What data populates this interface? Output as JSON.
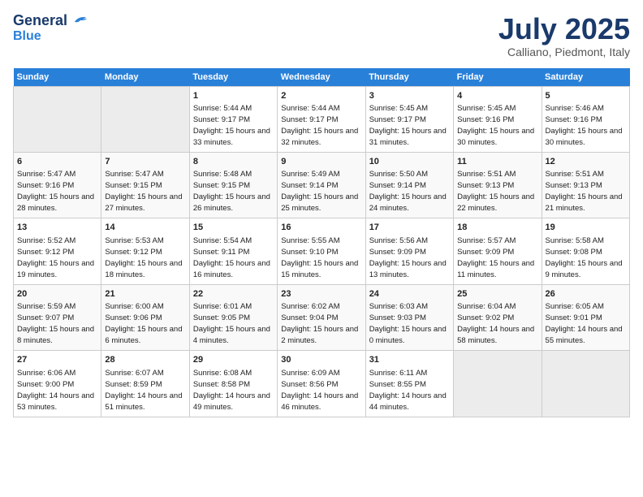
{
  "header": {
    "logo_line1": "General",
    "logo_line2": "Blue",
    "month": "July 2025",
    "location": "Calliano, Piedmont, Italy"
  },
  "columns": [
    "Sunday",
    "Monday",
    "Tuesday",
    "Wednesday",
    "Thursday",
    "Friday",
    "Saturday"
  ],
  "weeks": [
    [
      {
        "day": "",
        "sunrise": "",
        "sunset": "",
        "daylight": ""
      },
      {
        "day": "",
        "sunrise": "",
        "sunset": "",
        "daylight": ""
      },
      {
        "day": "1",
        "sunrise": "Sunrise: 5:44 AM",
        "sunset": "Sunset: 9:17 PM",
        "daylight": "Daylight: 15 hours and 33 minutes."
      },
      {
        "day": "2",
        "sunrise": "Sunrise: 5:44 AM",
        "sunset": "Sunset: 9:17 PM",
        "daylight": "Daylight: 15 hours and 32 minutes."
      },
      {
        "day": "3",
        "sunrise": "Sunrise: 5:45 AM",
        "sunset": "Sunset: 9:17 PM",
        "daylight": "Daylight: 15 hours and 31 minutes."
      },
      {
        "day": "4",
        "sunrise": "Sunrise: 5:45 AM",
        "sunset": "Sunset: 9:16 PM",
        "daylight": "Daylight: 15 hours and 30 minutes."
      },
      {
        "day": "5",
        "sunrise": "Sunrise: 5:46 AM",
        "sunset": "Sunset: 9:16 PM",
        "daylight": "Daylight: 15 hours and 30 minutes."
      }
    ],
    [
      {
        "day": "6",
        "sunrise": "Sunrise: 5:47 AM",
        "sunset": "Sunset: 9:16 PM",
        "daylight": "Daylight: 15 hours and 28 minutes."
      },
      {
        "day": "7",
        "sunrise": "Sunrise: 5:47 AM",
        "sunset": "Sunset: 9:15 PM",
        "daylight": "Daylight: 15 hours and 27 minutes."
      },
      {
        "day": "8",
        "sunrise": "Sunrise: 5:48 AM",
        "sunset": "Sunset: 9:15 PM",
        "daylight": "Daylight: 15 hours and 26 minutes."
      },
      {
        "day": "9",
        "sunrise": "Sunrise: 5:49 AM",
        "sunset": "Sunset: 9:14 PM",
        "daylight": "Daylight: 15 hours and 25 minutes."
      },
      {
        "day": "10",
        "sunrise": "Sunrise: 5:50 AM",
        "sunset": "Sunset: 9:14 PM",
        "daylight": "Daylight: 15 hours and 24 minutes."
      },
      {
        "day": "11",
        "sunrise": "Sunrise: 5:51 AM",
        "sunset": "Sunset: 9:13 PM",
        "daylight": "Daylight: 15 hours and 22 minutes."
      },
      {
        "day": "12",
        "sunrise": "Sunrise: 5:51 AM",
        "sunset": "Sunset: 9:13 PM",
        "daylight": "Daylight: 15 hours and 21 minutes."
      }
    ],
    [
      {
        "day": "13",
        "sunrise": "Sunrise: 5:52 AM",
        "sunset": "Sunset: 9:12 PM",
        "daylight": "Daylight: 15 hours and 19 minutes."
      },
      {
        "day": "14",
        "sunrise": "Sunrise: 5:53 AM",
        "sunset": "Sunset: 9:12 PM",
        "daylight": "Daylight: 15 hours and 18 minutes."
      },
      {
        "day": "15",
        "sunrise": "Sunrise: 5:54 AM",
        "sunset": "Sunset: 9:11 PM",
        "daylight": "Daylight: 15 hours and 16 minutes."
      },
      {
        "day": "16",
        "sunrise": "Sunrise: 5:55 AM",
        "sunset": "Sunset: 9:10 PM",
        "daylight": "Daylight: 15 hours and 15 minutes."
      },
      {
        "day": "17",
        "sunrise": "Sunrise: 5:56 AM",
        "sunset": "Sunset: 9:09 PM",
        "daylight": "Daylight: 15 hours and 13 minutes."
      },
      {
        "day": "18",
        "sunrise": "Sunrise: 5:57 AM",
        "sunset": "Sunset: 9:09 PM",
        "daylight": "Daylight: 15 hours and 11 minutes."
      },
      {
        "day": "19",
        "sunrise": "Sunrise: 5:58 AM",
        "sunset": "Sunset: 9:08 PM",
        "daylight": "Daylight: 15 hours and 9 minutes."
      }
    ],
    [
      {
        "day": "20",
        "sunrise": "Sunrise: 5:59 AM",
        "sunset": "Sunset: 9:07 PM",
        "daylight": "Daylight: 15 hours and 8 minutes."
      },
      {
        "day": "21",
        "sunrise": "Sunrise: 6:00 AM",
        "sunset": "Sunset: 9:06 PM",
        "daylight": "Daylight: 15 hours and 6 minutes."
      },
      {
        "day": "22",
        "sunrise": "Sunrise: 6:01 AM",
        "sunset": "Sunset: 9:05 PM",
        "daylight": "Daylight: 15 hours and 4 minutes."
      },
      {
        "day": "23",
        "sunrise": "Sunrise: 6:02 AM",
        "sunset": "Sunset: 9:04 PM",
        "daylight": "Daylight: 15 hours and 2 minutes."
      },
      {
        "day": "24",
        "sunrise": "Sunrise: 6:03 AM",
        "sunset": "Sunset: 9:03 PM",
        "daylight": "Daylight: 15 hours and 0 minutes."
      },
      {
        "day": "25",
        "sunrise": "Sunrise: 6:04 AM",
        "sunset": "Sunset: 9:02 PM",
        "daylight": "Daylight: 14 hours and 58 minutes."
      },
      {
        "day": "26",
        "sunrise": "Sunrise: 6:05 AM",
        "sunset": "Sunset: 9:01 PM",
        "daylight": "Daylight: 14 hours and 55 minutes."
      }
    ],
    [
      {
        "day": "27",
        "sunrise": "Sunrise: 6:06 AM",
        "sunset": "Sunset: 9:00 PM",
        "daylight": "Daylight: 14 hours and 53 minutes."
      },
      {
        "day": "28",
        "sunrise": "Sunrise: 6:07 AM",
        "sunset": "Sunset: 8:59 PM",
        "daylight": "Daylight: 14 hours and 51 minutes."
      },
      {
        "day": "29",
        "sunrise": "Sunrise: 6:08 AM",
        "sunset": "Sunset: 8:58 PM",
        "daylight": "Daylight: 14 hours and 49 minutes."
      },
      {
        "day": "30",
        "sunrise": "Sunrise: 6:09 AM",
        "sunset": "Sunset: 8:56 PM",
        "daylight": "Daylight: 14 hours and 46 minutes."
      },
      {
        "day": "31",
        "sunrise": "Sunrise: 6:11 AM",
        "sunset": "Sunset: 8:55 PM",
        "daylight": "Daylight: 14 hours and 44 minutes."
      },
      {
        "day": "",
        "sunrise": "",
        "sunset": "",
        "daylight": ""
      },
      {
        "day": "",
        "sunrise": "",
        "sunset": "",
        "daylight": ""
      }
    ]
  ]
}
